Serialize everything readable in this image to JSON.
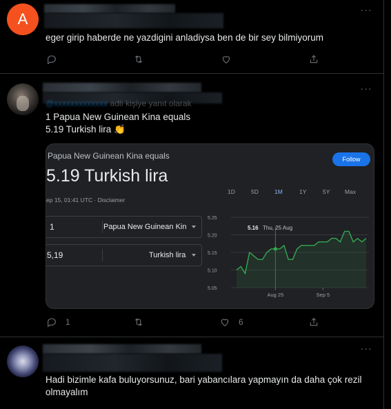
{
  "tweet1": {
    "avatar_letter": "A",
    "avatar_color": "#f4511e",
    "text": "eger girip haberde ne yazdigini anladiysa ben de bir sey bilmiyorum"
  },
  "tweet2": {
    "reply_partial": "adlı kişiye yanıt olarak",
    "text_line1": "1 Papua New Guinean Kina equals",
    "text_line2": "5.19 Turkish lira 👏",
    "reply_count": "1",
    "like_count": "6",
    "card": {
      "header": "Papua New Guinean Kina equals",
      "big": "5.19 Turkish lira",
      "date": "ep 15, 01:41 UTC · Disclaimer",
      "follow": "Follow",
      "from_value": "1",
      "from_currency": "Papua New Guinean Kin",
      "to_value": "5,19",
      "to_currency": "Turkish lira",
      "ranges": [
        "1D",
        "5D",
        "1M",
        "1Y",
        "5Y",
        "Max"
      ],
      "active_range": "1M",
      "accent": "#8ab4f8",
      "line_color": "#34a853"
    }
  },
  "tweet3": {
    "text": "Hadi bizimle kafa buluyorsunuz, bari yabancılara yapmayın da daha çok rezil olmayalım"
  },
  "chart_data": {
    "type": "line",
    "y_ticks": [
      "5.25",
      "5.20",
      "5.15",
      "5.10",
      "5.05"
    ],
    "x_ticks": [
      "Aug 25",
      "Sep 5"
    ],
    "ylim": [
      5.05,
      5.25
    ],
    "tooltip_value": "5.16",
    "tooltip_date": "Thu, 25 Aug",
    "values": [
      5.1,
      5.11,
      5.09,
      5.15,
      5.14,
      5.13,
      5.13,
      5.15,
      5.16,
      5.16,
      5.16,
      5.17,
      5.13,
      5.13,
      5.16,
      5.17,
      5.17,
      5.17,
      5.17,
      5.18,
      5.18,
      5.18,
      5.19,
      5.19,
      5.18,
      5.21,
      5.21,
      5.18,
      5.19,
      5.18,
      5.19
    ]
  }
}
